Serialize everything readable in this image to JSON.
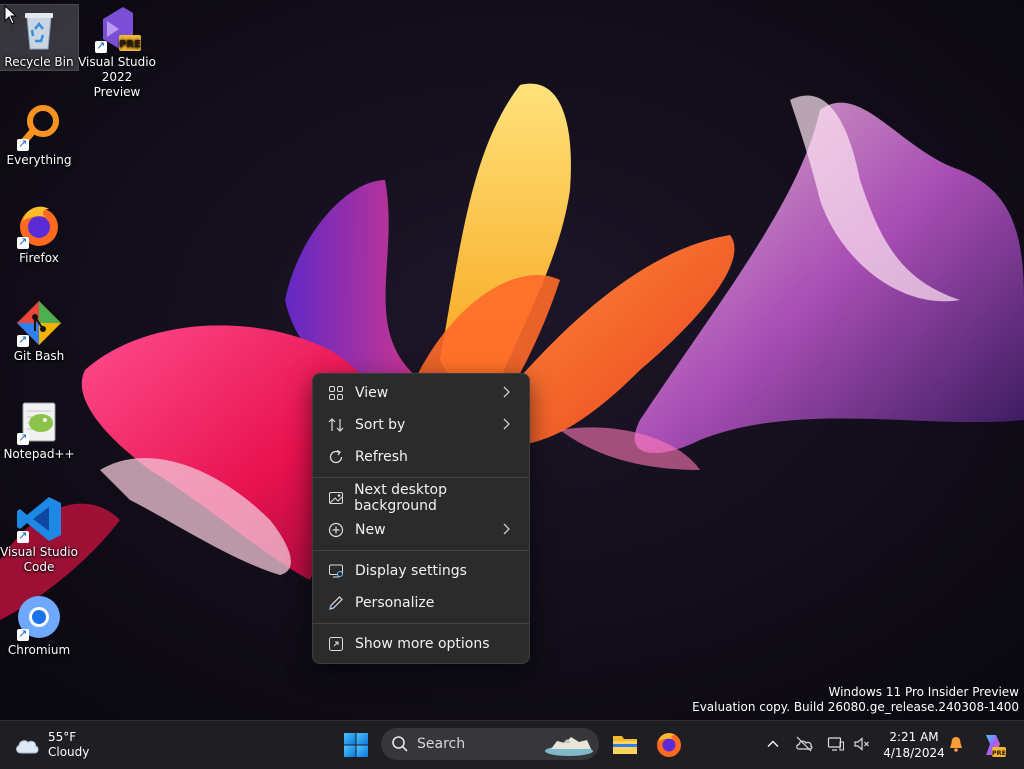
{
  "desktop": {
    "icons": [
      {
        "label": "Recycle Bin",
        "icon": "recycle-bin-icon"
      },
      {
        "label": "Visual Studio 2022 Preview",
        "icon": "visual-studio-icon",
        "badge": "PRE"
      },
      {
        "label": "Everything",
        "icon": "everything-search-icon"
      },
      {
        "label": "Firefox",
        "icon": "firefox-icon"
      },
      {
        "label": "Git Bash",
        "icon": "git-bash-icon"
      },
      {
        "label": "Notepad++",
        "icon": "notepad-plus-plus-icon"
      },
      {
        "label": "Visual Studio Code",
        "icon": "vscode-icon"
      },
      {
        "label": "Chromium",
        "icon": "chromium-icon"
      }
    ]
  },
  "context_menu": {
    "items": [
      {
        "label": "View",
        "icon": "grid-view-icon",
        "submenu": true
      },
      {
        "label": "Sort by",
        "icon": "sort-icon",
        "submenu": true
      },
      {
        "label": "Refresh",
        "icon": "refresh-icon",
        "submenu": false
      },
      {
        "label": "Next desktop background",
        "icon": "next-background-icon",
        "submenu": false
      },
      {
        "label": "New",
        "icon": "new-plus-icon",
        "submenu": true
      },
      {
        "label": "Display settings",
        "icon": "display-settings-icon",
        "submenu": false
      },
      {
        "label": "Personalize",
        "icon": "pen-icon",
        "submenu": false
      },
      {
        "label": "Show more options",
        "icon": "more-options-icon",
        "submenu": false
      }
    ]
  },
  "watermark": {
    "line1": "Windows 11 Pro Insider Preview",
    "line2": "Evaluation copy. Build 26080.ge_release.240308-1400"
  },
  "taskbar": {
    "weather": {
      "temp": "55°F",
      "condition": "Cloudy"
    },
    "search_label": "Search",
    "clock": {
      "time": "2:21 AM",
      "date": "4/18/2024"
    },
    "copilot_badge": "PRE"
  },
  "colors": {
    "accent": "#0078d4",
    "menu_bg": "#2b2b2b",
    "taskbar_bg": "#1f1f23"
  }
}
